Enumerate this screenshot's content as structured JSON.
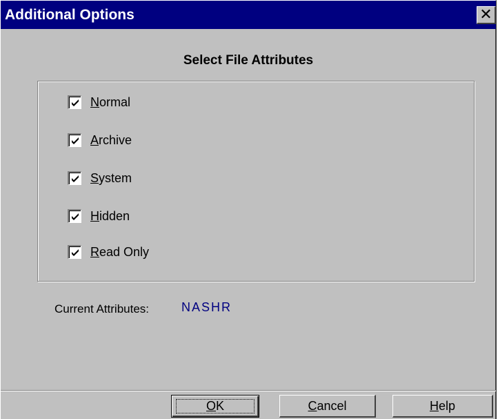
{
  "window": {
    "title": "Additional Options",
    "close_glyph": "✕",
    "colors": {
      "titlebar": "#000080",
      "face": "#c0c0c0",
      "value_text": "#000080"
    }
  },
  "heading": "Select File Attributes",
  "attributes": [
    {
      "label_mnemonic": "N",
      "label_rest": "ormal",
      "checked": true,
      "icon": "checkmark-icon"
    },
    {
      "label_mnemonic": "A",
      "label_rest": "rchive",
      "checked": true,
      "icon": "checkmark-icon"
    },
    {
      "label_mnemonic": "S",
      "label_rest": "ystem",
      "checked": true,
      "icon": "checkmark-icon"
    },
    {
      "label_mnemonic": "H",
      "label_rest": "idden",
      "checked": true,
      "icon": "checkmark-icon"
    },
    {
      "label_mnemonic": "R",
      "label_rest": "ead Only",
      "checked": true,
      "icon": "checkmark-icon"
    }
  ],
  "current": {
    "label": "Current Attributes:",
    "value": "NASHR"
  },
  "buttons": {
    "ok": {
      "mnemonic": "O",
      "rest": "K"
    },
    "cancel": {
      "mnemonic": "C",
      "rest": "ancel"
    },
    "help": {
      "mnemonic": "H",
      "rest": "elp"
    }
  }
}
